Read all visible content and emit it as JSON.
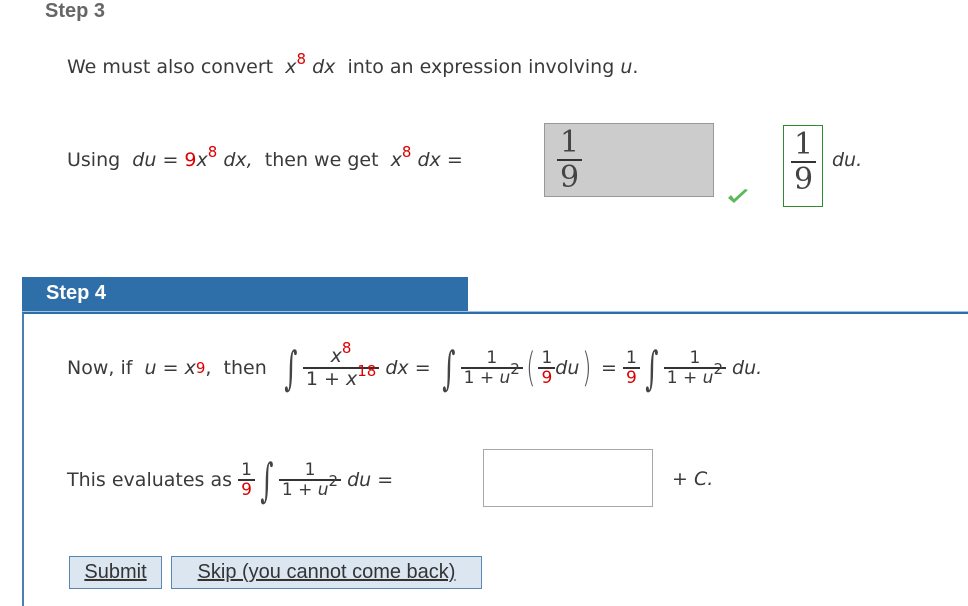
{
  "step3": {
    "heading": "Step 3",
    "intro_prefix": "We must also convert",
    "intro_expr_base": "x",
    "intro_expr_exp": "8",
    "intro_expr_dx": "dx",
    "intro_suffix": "into an expression involving",
    "intro_var": "u",
    "intro_end": ".",
    "line2": {
      "using": "Using",
      "du": "du",
      "eq": "=",
      "coef": "9",
      "x": "x",
      "exp": "8",
      "dx": "dx,",
      "then": "then we get",
      "x2": "x",
      "exp2": "8",
      "dx2": "dx",
      "eq2": "=",
      "du_end": "du."
    },
    "answer_input": {
      "numerator": "1",
      "denominator": "9",
      "state": "graded"
    },
    "correct_answer": {
      "numerator": "1",
      "denominator": "9"
    },
    "status_icon": "check-icon",
    "status_color": "#5cb85c"
  },
  "step4": {
    "heading": "Step 4",
    "header_color": "#2f6fa9",
    "line1": {
      "prefix": "Now, if",
      "u": "u",
      "eq": "=",
      "x": "x",
      "exp": "9",
      "comma": ",",
      "then": "then",
      "num_x": "x",
      "num_exp": "8",
      "den_one": "1 +",
      "den_x": "x",
      "den_exp": "18",
      "dx": "dx",
      "eq2": "=",
      "f1_num": "1",
      "f1_den": "1 +",
      "f1_den_var": "u",
      "f1_den_exp": "2",
      "f2_num": "1",
      "f2_den": "9",
      "du": "du",
      "eq3": "=",
      "f3_num": "1",
      "f3_den": "9",
      "f4_num": "1",
      "f4_den": "1 +",
      "f4_den_var": "u",
      "f4_den_exp": "2",
      "du_end": "du."
    },
    "line2": {
      "prefix": "This evaluates as",
      "f_num": "1",
      "f_den": "9",
      "g_num": "1",
      "g_den": "1 +",
      "g_den_var": "u",
      "g_den_exp": "2",
      "du": "du",
      "eq": "=",
      "answer_value": "",
      "suffix": "+",
      "c": "C."
    },
    "buttons": {
      "submit": "Submit",
      "skip": "Skip (you cannot come back)"
    }
  }
}
